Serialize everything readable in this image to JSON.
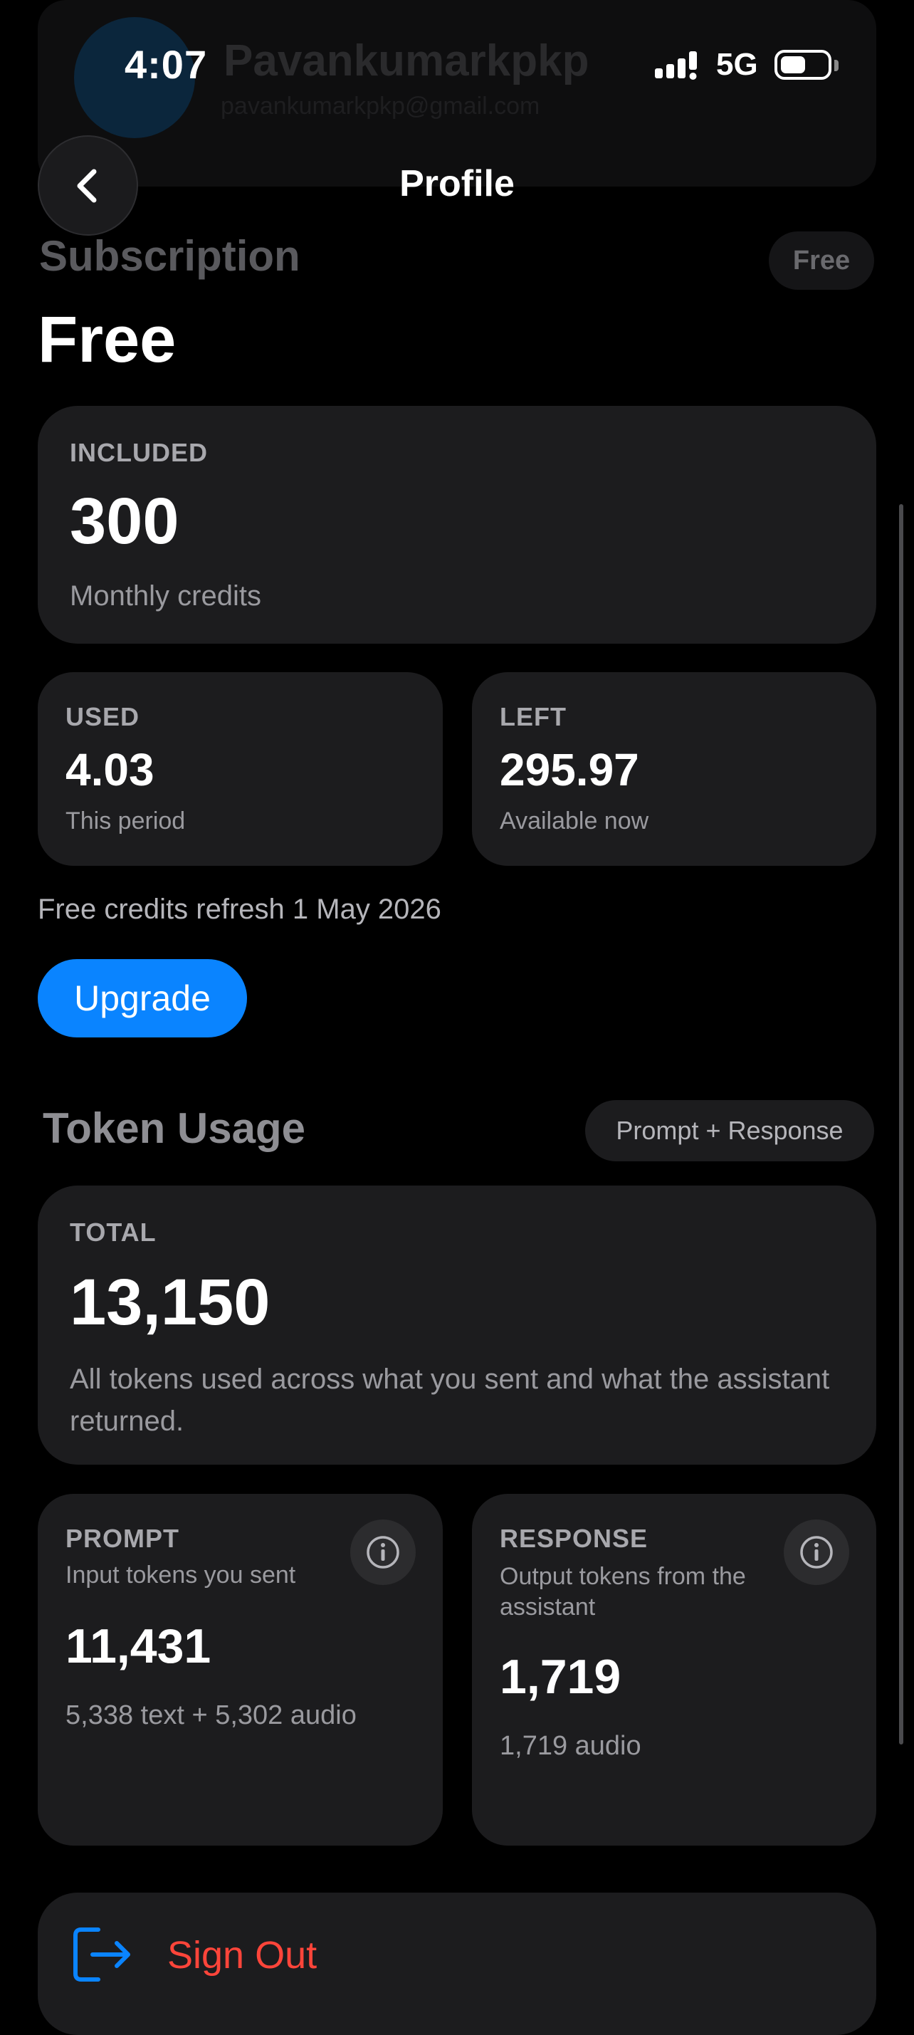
{
  "status_bar": {
    "time": "4:07",
    "network": "5G"
  },
  "profile_header": {
    "name": "Pavankumarkpkp",
    "email": "pavankumarkpkp@gmail.com"
  },
  "nav": {
    "title": "Profile",
    "back_icon": "chevron-left-icon"
  },
  "subscription": {
    "heading": "Subscription",
    "badge": "Free",
    "plan": "Free",
    "included": {
      "label": "INCLUDED",
      "value": "300",
      "caption": "Monthly credits"
    },
    "used": {
      "label": "USED",
      "value": "4.03",
      "caption": "This period"
    },
    "left": {
      "label": "LEFT",
      "value": "295.97",
      "caption": "Available now"
    },
    "refresh_text": "Free credits refresh 1 May 2026",
    "upgrade_label": "Upgrade"
  },
  "token_usage": {
    "heading": "Token Usage",
    "chip": "Prompt + Response",
    "total": {
      "label": "TOTAL",
      "value": "13,150",
      "description": "All tokens used across what you sent and what the assistant returned."
    },
    "prompt": {
      "label": "PROMPT",
      "subtitle": "Input tokens you sent",
      "value": "11,431",
      "breakdown": "5,338 text + 5,302 audio"
    },
    "response": {
      "label": "RESPONSE",
      "subtitle": "Output tokens from the assistant",
      "value": "1,719",
      "breakdown": "1,719 audio"
    }
  },
  "sign_out": {
    "label": "Sign Out"
  },
  "colors": {
    "accent": "#0a84ff",
    "danger": "#ff453a",
    "card": "#1c1c1e",
    "background": "#000000"
  }
}
